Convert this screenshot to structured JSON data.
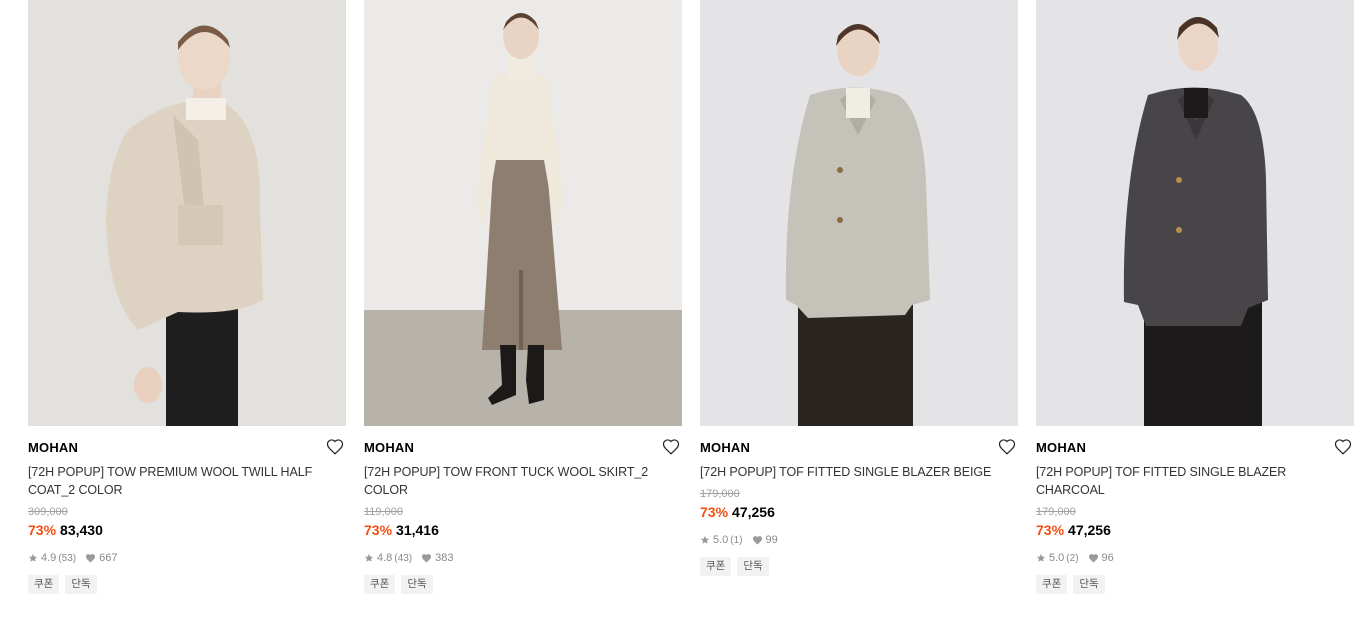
{
  "products": [
    {
      "brand": "MOHAN",
      "name": "[72H POPUP] TOW PREMIUM WOOL TWILL HALF COAT_2 COLOR",
      "original_price": "309,000",
      "discount": "73%",
      "price": "83,430",
      "rating": "4.9",
      "review_count": "(53)",
      "likes": "667",
      "tags": [
        "쿠폰",
        "단독"
      ],
      "image": "model-beige-half-coat"
    },
    {
      "brand": "MOHAN",
      "name": "[72H POPUP] TOW FRONT TUCK WOOL SKIRT_2 COLOR",
      "original_price": "119,000",
      "discount": "73%",
      "price": "31,416",
      "rating": "4.8",
      "review_count": "(43)",
      "likes": "383",
      "tags": [
        "쿠폰",
        "단독"
      ],
      "image": "model-wool-skirt"
    },
    {
      "brand": "MOHAN",
      "name": "[72H POPUP] TOF FITTED SINGLE BLAZER BEIGE",
      "original_price": "179,000",
      "discount": "73%",
      "price": "47,256",
      "rating": "5.0",
      "review_count": "(1)",
      "likes": "99",
      "tags": [
        "쿠폰",
        "단독"
      ],
      "image": "model-beige-blazer"
    },
    {
      "brand": "MOHAN",
      "name": "[72H POPUP] TOF FITTED SINGLE BLAZER CHARCOAL",
      "original_price": "179,000",
      "discount": "73%",
      "price": "47,256",
      "rating": "5.0",
      "review_count": "(2)",
      "likes": "96",
      "tags": [
        "쿠폰",
        "단독"
      ],
      "image": "model-charcoal-blazer"
    }
  ],
  "colors": {
    "discount": "#f34f11",
    "muted": "#8a8a8a",
    "tag_bg": "#f2f2f2"
  },
  "icons": {
    "wishlist": "heart-outline-icon",
    "rating": "star-icon",
    "likes": "heart-filled-icon"
  }
}
